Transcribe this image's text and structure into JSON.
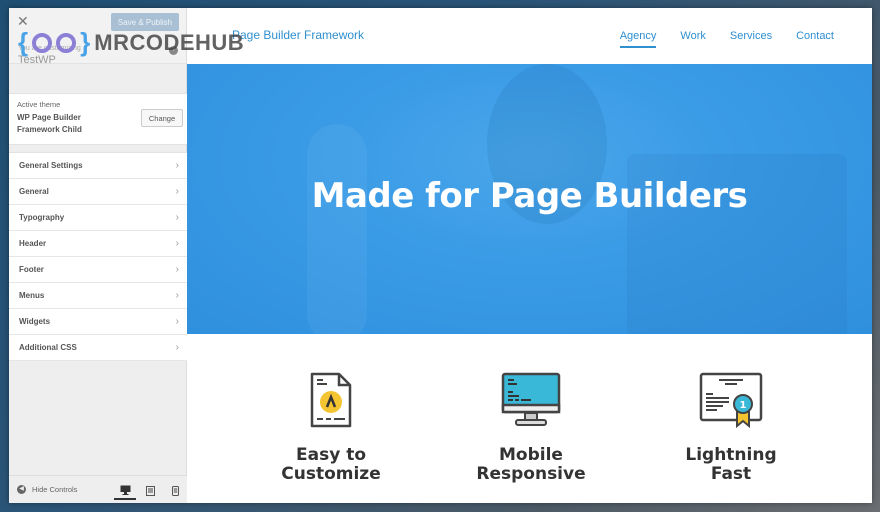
{
  "watermark": {
    "text": "MRCODEHUB"
  },
  "sidebar": {
    "publish_label": "Save & Publish",
    "customizing_label": "You are customizing",
    "site_name": "TestWP",
    "theme": {
      "label": "Active theme",
      "name": "WP Page Builder Framework Child",
      "change_label": "Change"
    },
    "items": [
      {
        "label": "General Settings"
      },
      {
        "label": "General"
      },
      {
        "label": "Typography"
      },
      {
        "label": "Header"
      },
      {
        "label": "Footer"
      },
      {
        "label": "Menus"
      },
      {
        "label": "Widgets"
      },
      {
        "label": "Additional CSS"
      }
    ],
    "footer": {
      "hide_controls": "Hide Controls",
      "devices": [
        "desktop",
        "tablet",
        "mobile"
      ],
      "active_device": "desktop"
    }
  },
  "preview": {
    "site_title": "Page Builder Framework",
    "nav": [
      {
        "label": "Agency",
        "active": true
      },
      {
        "label": "Work"
      },
      {
        "label": "Services"
      },
      {
        "label": "Contact"
      }
    ],
    "hero_heading": "Made for Page Builders",
    "features": [
      {
        "line1": "Easy to",
        "line2": "Customize",
        "icon": "document-icon"
      },
      {
        "line1": "Mobile",
        "line2": "Responsive",
        "icon": "monitor-icon"
      },
      {
        "line1": "Lightning",
        "line2": "Fast",
        "icon": "certificate-icon"
      }
    ],
    "colors": {
      "accent": "#2f8fcf",
      "hero": "#3a9be6",
      "yellow": "#f5c531",
      "teal": "#3ab8d8"
    }
  }
}
